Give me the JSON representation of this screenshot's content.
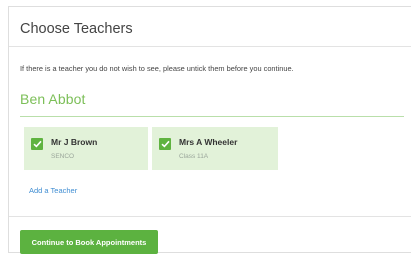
{
  "header": {
    "title": "Choose Teachers"
  },
  "intro": "If there is a teacher you do not wish to see, please untick them before you continue.",
  "student": {
    "name": "Ben Abbot"
  },
  "teachers": [
    {
      "name": "Mr J Brown",
      "subtitle": "SENCO",
      "checked": true
    },
    {
      "name": "Mrs A Wheeler",
      "subtitle": "Class 11A",
      "checked": true
    }
  ],
  "add_teacher_label": "Add a Teacher",
  "continue_label": "Continue to Book Appointments",
  "colors": {
    "accent": "#5cb240",
    "card_bg": "#e2f2d9",
    "link": "#3f8dd2",
    "student_name": "#7cbf58"
  }
}
